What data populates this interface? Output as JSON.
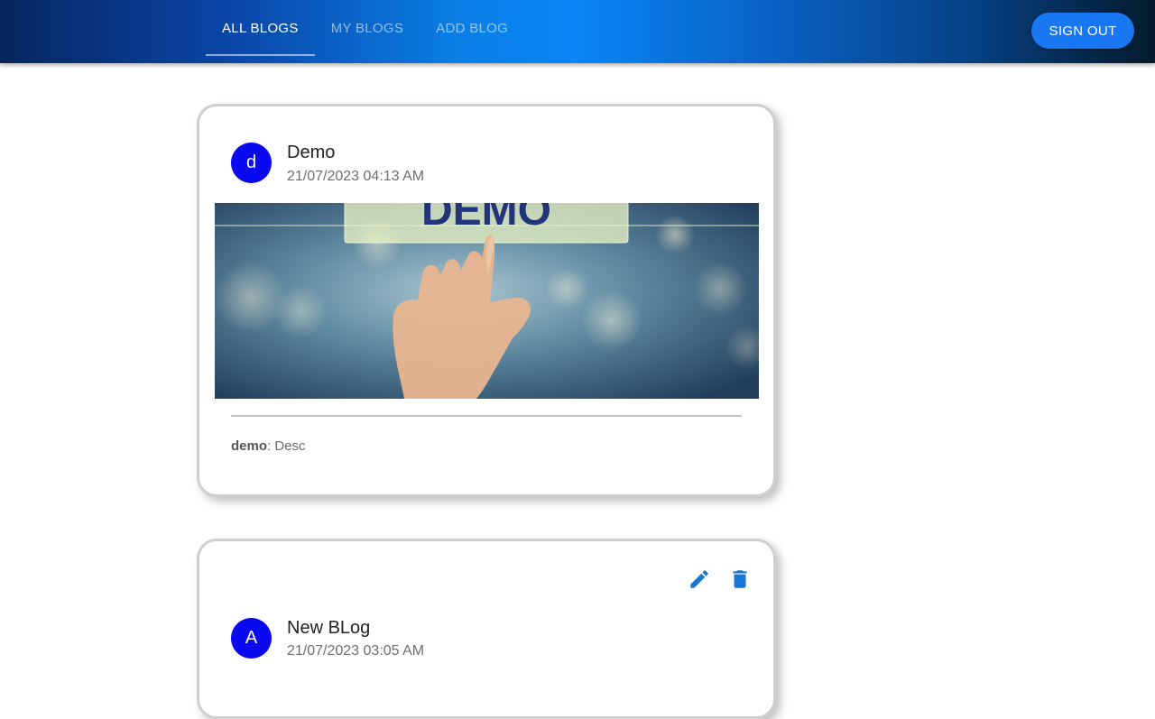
{
  "header": {
    "tabs": [
      {
        "label": "ALL BLOGS",
        "active": true
      },
      {
        "label": "MY BLOGS",
        "active": false
      },
      {
        "label": "ADD BLOG",
        "active": false
      }
    ],
    "signout_label": "SIGN OUT"
  },
  "blogs": [
    {
      "avatar_letter": "d",
      "title": "Demo",
      "date": "21/07/2023 04:13 AM",
      "image_text": "DEMO",
      "author": "demo",
      "description": ": Desc"
    },
    {
      "avatar_letter": "A",
      "title": "New BLog",
      "date": "21/07/2023 03:05 AM"
    }
  ],
  "colors": {
    "avatar": "#0a0af0",
    "signout": "#1877f2",
    "action_icons": "#1976d2"
  },
  "icons": {
    "edit": "edit-icon",
    "delete": "delete-icon"
  }
}
